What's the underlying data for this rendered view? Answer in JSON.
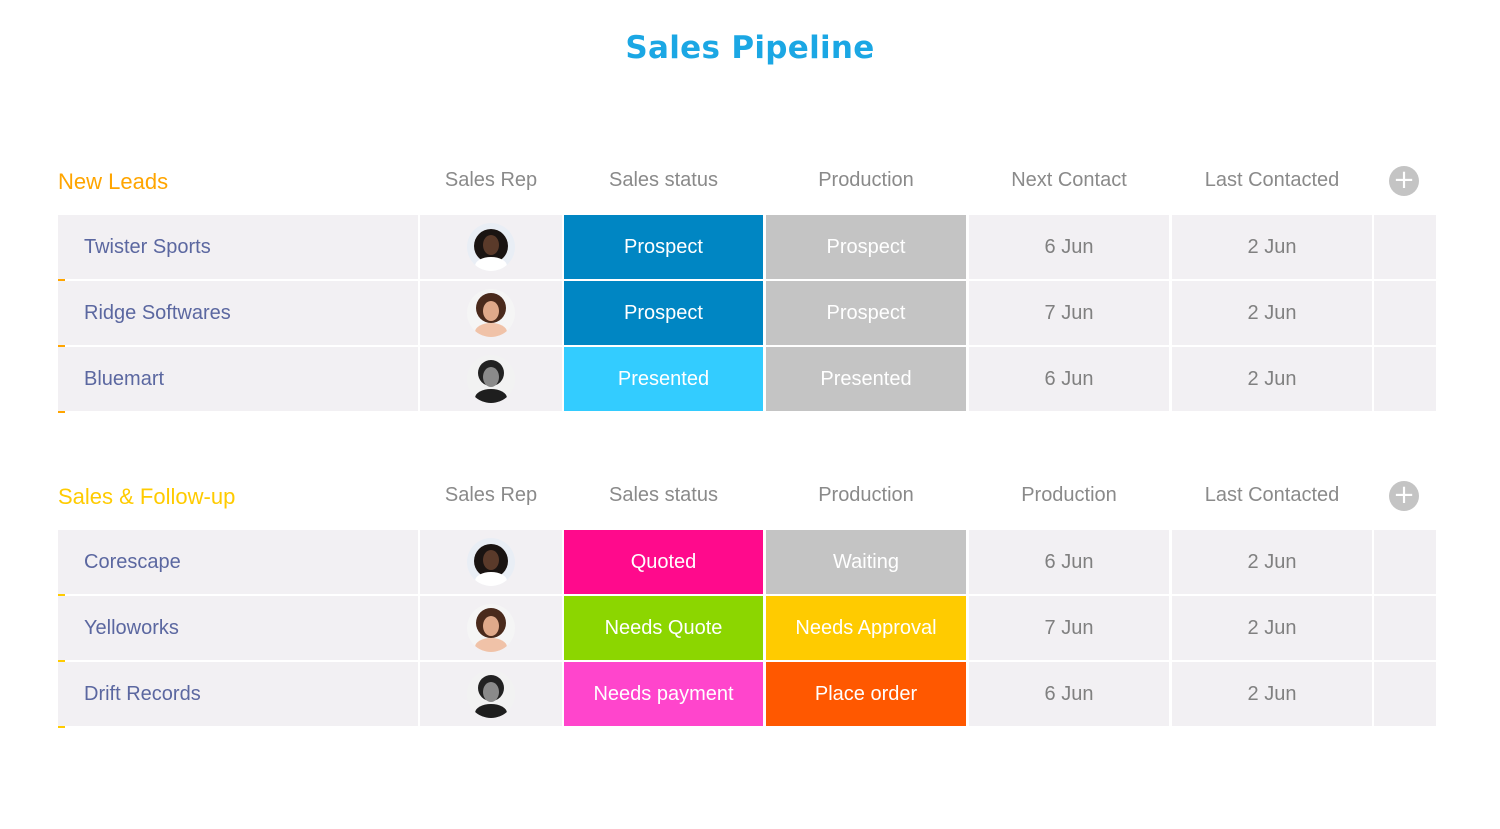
{
  "page": {
    "title": "Sales Pipeline"
  },
  "colors": {
    "title": "#1ba7e4",
    "prospect": "#0086c3",
    "presented": "#33ccff",
    "gray": "#c4c4c4",
    "quoted": "#ff0a8c",
    "needs_quote": "#8cd600",
    "needs_approval": "#ffcb00",
    "needs_payment": "#ff45cc",
    "place_order": "#ff5800"
  },
  "groups": [
    {
      "title": "New Leads",
      "color": "#ffa500",
      "columns": [
        "Sales Rep",
        "Sales status",
        "Production",
        "Next Contact",
        "Last Contacted"
      ],
      "add_icon": "plus-circle-icon",
      "rows": [
        {
          "name": "Twister Sports",
          "rep": "avatar-woman-curly",
          "status": "Prospect",
          "status_color": "#0086c3",
          "production": "Prospect",
          "production_color": "#c4c4c4",
          "next": "6 Jun",
          "last": "2 Jun"
        },
        {
          "name": "Ridge Softwares",
          "rep": "avatar-woman-brown-hair",
          "status": "Prospect",
          "status_color": "#0086c3",
          "production": "Prospect",
          "production_color": "#c4c4c4",
          "next": "7 Jun",
          "last": "2 Jun"
        },
        {
          "name": "Bluemart",
          "rep": "avatar-man-glasses",
          "status": "Presented",
          "status_color": "#33ccff",
          "production": "Presented",
          "production_color": "#c4c4c4",
          "next": "6 Jun",
          "last": "2 Jun"
        }
      ]
    },
    {
      "title": "Sales & Follow-up",
      "color": "#ffcb00",
      "columns": [
        "Sales Rep",
        "Sales status",
        "Production",
        "Production",
        "Last Contacted"
      ],
      "add_icon": "plus-circle-icon",
      "rows": [
        {
          "name": "Corescape",
          "rep": "avatar-woman-curly",
          "status": "Quoted",
          "status_color": "#ff0a8c",
          "production": "Waiting",
          "production_color": "#c4c4c4",
          "next": "6 Jun",
          "last": "2 Jun"
        },
        {
          "name": "Yelloworks",
          "rep": "avatar-woman-brown-hair",
          "status": "Needs Quote",
          "status_color": "#8cd600",
          "production": "Needs Approval",
          "production_color": "#ffcb00",
          "next": "7 Jun",
          "last": "2 Jun"
        },
        {
          "name": "Drift Records",
          "rep": "avatar-man-glasses",
          "status": "Needs payment",
          "status_color": "#ff45cc",
          "production": "Place order",
          "production_color": "#ff5800",
          "next": "6 Jun",
          "last": "2 Jun"
        }
      ]
    }
  ]
}
